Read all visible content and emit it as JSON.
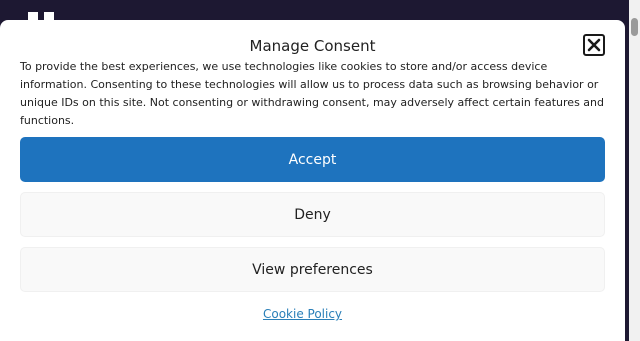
{
  "background": {
    "color": "#1d1832"
  },
  "modal": {
    "title": "Manage Consent",
    "close_icon": "close-x-icon",
    "description": "To provide the best experiences, we use technologies like cookies to store and/or access device information. Consenting to these technologies will allow us to process data such as browsing behavior or unique IDs on this site. Not consenting or withdrawing consent, may adversely affect certain features and functions.",
    "buttons": {
      "accept": "Accept",
      "deny": "Deny",
      "preferences": "View preferences"
    },
    "policy_link": "Cookie Policy",
    "accent_color": "#1e73be"
  }
}
